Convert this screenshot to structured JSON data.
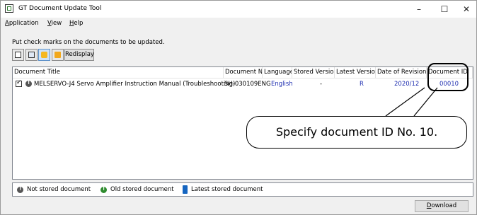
{
  "window": {
    "title": "GT Document Update Tool",
    "controls": {
      "minimize": "–",
      "maximize": "☐",
      "close": "✕"
    }
  },
  "menubar": {
    "items": [
      {
        "label": "Application",
        "accel": "A",
        "rest": "pplication"
      },
      {
        "label": "View",
        "accel": "V",
        "rest": "iew"
      },
      {
        "label": "Help",
        "accel": "H",
        "rest": "elp"
      }
    ]
  },
  "instruction": "Put check marks on the documents to be updated.",
  "toolbar": {
    "icons": [
      "check-all-icon",
      "uncheck-all-icon",
      "star-folder-icon",
      "open-folder-icon"
    ],
    "redisplay_label": "Redisplay"
  },
  "table": {
    "columns": [
      "Document Title",
      "Document No.",
      "Language",
      "Stored Version",
      "Latest Version",
      "Date of Revision",
      "Document ID"
    ],
    "rows": [
      {
        "checked": true,
        "status": "not-stored",
        "title": "MELSERVO-J4 Servo Amplifier Instruction Manual (Troubleshooting)",
        "doc_no": "SH-030109ENG",
        "language": "English",
        "stored_version": "-",
        "latest_version": "R",
        "date": "2020/12",
        "doc_id": "00010"
      }
    ]
  },
  "legend": {
    "not_stored": "Not stored document",
    "old_stored": "Old stored document",
    "latest_stored": "Latest stored document"
  },
  "download_button": {
    "accel": "D",
    "rest": "ownload"
  },
  "callout": "Specify document ID No. 10.",
  "colors": {
    "not_stored": "#555555",
    "old_stored": "#2e8b2e",
    "latest_stored": "#1565c0",
    "link_blue": "#1f2fb0"
  }
}
